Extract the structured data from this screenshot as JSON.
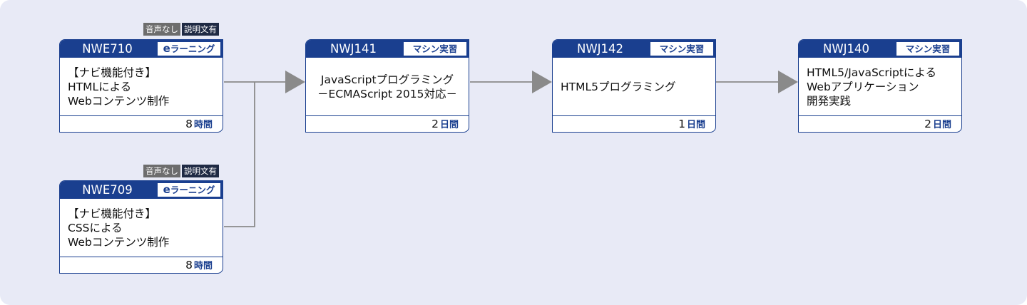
{
  "badges": {
    "audio": "音声なし",
    "text": "説明文有"
  },
  "courses": [
    {
      "code": "NWE710",
      "type": "ラーニング",
      "type_prefix": "e",
      "title_lines": [
        "【ナビ機能付き】",
        "HTMLによる",
        "Webコンテンツ制作"
      ],
      "duration": "8",
      "unit": "時間"
    },
    {
      "code": "NWE709",
      "type": "ラーニング",
      "type_prefix": "e",
      "title_lines": [
        "【ナビ機能付き】",
        "CSSによる",
        "Webコンテンツ制作"
      ],
      "duration": "8",
      "unit": "時間"
    },
    {
      "code": "NWJ141",
      "type": "マシン実習",
      "title_lines": [
        "JavaScriptプログラミング",
        "－ECMAScript 2015対応－"
      ],
      "duration": "2",
      "unit": "日間"
    },
    {
      "code": "NWJ142",
      "type": "マシン実習",
      "title_lines": [
        "HTML5プログラミング"
      ],
      "duration": "1",
      "unit": "日間"
    },
    {
      "code": "NWJ140",
      "type": "マシン実習",
      "title_lines": [
        "HTML5/JavaScriptによる",
        "Webアプリケーション",
        "開発実践"
      ],
      "duration": "2",
      "unit": "日間"
    }
  ],
  "colors": {
    "background": "#e8eaf6",
    "card_header": "#1a3f8f",
    "connector": "#8a8a8a",
    "badge_audio": "#6d6d6d",
    "badge_text": "#1f2a44"
  }
}
